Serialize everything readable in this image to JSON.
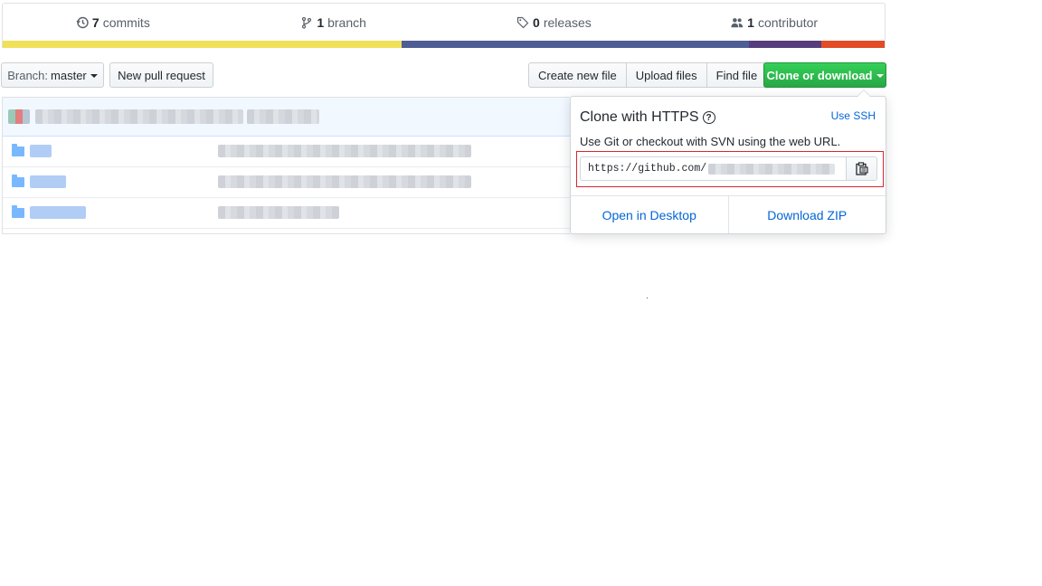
{
  "stats": {
    "commits": {
      "count": "7",
      "label": "commits"
    },
    "branches": {
      "count": "1",
      "label": "branch"
    },
    "releases": {
      "count": "0",
      "label": "releases"
    },
    "contributors": {
      "count": "1",
      "label": "contributor"
    }
  },
  "language_bar": {
    "segments": [
      {
        "color": "#f1e05a",
        "percent": 45.2
      },
      {
        "color": "#4f5d95",
        "percent": 39.4
      },
      {
        "color": "#563d7c",
        "percent": 8.2
      },
      {
        "color": "#e34c26",
        "percent": 7.2
      }
    ]
  },
  "toolbar": {
    "branch_prefix": "Branch:",
    "branch_name": "master",
    "new_pull_request": "New pull request",
    "create_new_file": "Create new file",
    "upload_files": "Upload files",
    "find_file": "Find file",
    "clone_or_download": "Clone or download"
  },
  "clone_popover": {
    "title": "Clone with HTTPS",
    "help_glyph": "?",
    "use_ssh": "Use SSH",
    "description": "Use Git or checkout with SVN using the web URL.",
    "url_prefix": "https://github.com/",
    "open_in_desktop": "Open in Desktop",
    "download_zip": "Download ZIP"
  },
  "colors": {
    "accent_link": "#0366d6",
    "clone_button": "#28a745",
    "highlight_box": "#d7282f"
  }
}
